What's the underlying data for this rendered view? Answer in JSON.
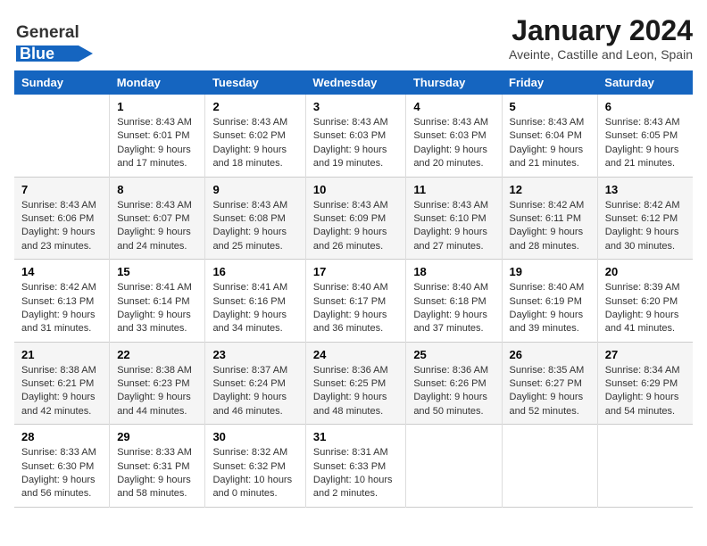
{
  "logo": {
    "general": "General",
    "blue": "Blue"
  },
  "header": {
    "title": "January 2024",
    "subtitle": "Aveinte, Castille and Leon, Spain"
  },
  "weekdays": [
    "Sunday",
    "Monday",
    "Tuesday",
    "Wednesday",
    "Thursday",
    "Friday",
    "Saturday"
  ],
  "weeks": [
    [
      {
        "day": "",
        "content": ""
      },
      {
        "day": "1",
        "content": "Sunrise: 8:43 AM\nSunset: 6:01 PM\nDaylight: 9 hours\nand 17 minutes."
      },
      {
        "day": "2",
        "content": "Sunrise: 8:43 AM\nSunset: 6:02 PM\nDaylight: 9 hours\nand 18 minutes."
      },
      {
        "day": "3",
        "content": "Sunrise: 8:43 AM\nSunset: 6:03 PM\nDaylight: 9 hours\nand 19 minutes."
      },
      {
        "day": "4",
        "content": "Sunrise: 8:43 AM\nSunset: 6:03 PM\nDaylight: 9 hours\nand 20 minutes."
      },
      {
        "day": "5",
        "content": "Sunrise: 8:43 AM\nSunset: 6:04 PM\nDaylight: 9 hours\nand 21 minutes."
      },
      {
        "day": "6",
        "content": "Sunrise: 8:43 AM\nSunset: 6:05 PM\nDaylight: 9 hours\nand 21 minutes."
      }
    ],
    [
      {
        "day": "7",
        "content": "Sunrise: 8:43 AM\nSunset: 6:06 PM\nDaylight: 9 hours\nand 23 minutes."
      },
      {
        "day": "8",
        "content": "Sunrise: 8:43 AM\nSunset: 6:07 PM\nDaylight: 9 hours\nand 24 minutes."
      },
      {
        "day": "9",
        "content": "Sunrise: 8:43 AM\nSunset: 6:08 PM\nDaylight: 9 hours\nand 25 minutes."
      },
      {
        "day": "10",
        "content": "Sunrise: 8:43 AM\nSunset: 6:09 PM\nDaylight: 9 hours\nand 26 minutes."
      },
      {
        "day": "11",
        "content": "Sunrise: 8:43 AM\nSunset: 6:10 PM\nDaylight: 9 hours\nand 27 minutes."
      },
      {
        "day": "12",
        "content": "Sunrise: 8:42 AM\nSunset: 6:11 PM\nDaylight: 9 hours\nand 28 minutes."
      },
      {
        "day": "13",
        "content": "Sunrise: 8:42 AM\nSunset: 6:12 PM\nDaylight: 9 hours\nand 30 minutes."
      }
    ],
    [
      {
        "day": "14",
        "content": "Sunrise: 8:42 AM\nSunset: 6:13 PM\nDaylight: 9 hours\nand 31 minutes."
      },
      {
        "day": "15",
        "content": "Sunrise: 8:41 AM\nSunset: 6:14 PM\nDaylight: 9 hours\nand 33 minutes."
      },
      {
        "day": "16",
        "content": "Sunrise: 8:41 AM\nSunset: 6:16 PM\nDaylight: 9 hours\nand 34 minutes."
      },
      {
        "day": "17",
        "content": "Sunrise: 8:40 AM\nSunset: 6:17 PM\nDaylight: 9 hours\nand 36 minutes."
      },
      {
        "day": "18",
        "content": "Sunrise: 8:40 AM\nSunset: 6:18 PM\nDaylight: 9 hours\nand 37 minutes."
      },
      {
        "day": "19",
        "content": "Sunrise: 8:40 AM\nSunset: 6:19 PM\nDaylight: 9 hours\nand 39 minutes."
      },
      {
        "day": "20",
        "content": "Sunrise: 8:39 AM\nSunset: 6:20 PM\nDaylight: 9 hours\nand 41 minutes."
      }
    ],
    [
      {
        "day": "21",
        "content": "Sunrise: 8:38 AM\nSunset: 6:21 PM\nDaylight: 9 hours\nand 42 minutes."
      },
      {
        "day": "22",
        "content": "Sunrise: 8:38 AM\nSunset: 6:23 PM\nDaylight: 9 hours\nand 44 minutes."
      },
      {
        "day": "23",
        "content": "Sunrise: 8:37 AM\nSunset: 6:24 PM\nDaylight: 9 hours\nand 46 minutes."
      },
      {
        "day": "24",
        "content": "Sunrise: 8:36 AM\nSunset: 6:25 PM\nDaylight: 9 hours\nand 48 minutes."
      },
      {
        "day": "25",
        "content": "Sunrise: 8:36 AM\nSunset: 6:26 PM\nDaylight: 9 hours\nand 50 minutes."
      },
      {
        "day": "26",
        "content": "Sunrise: 8:35 AM\nSunset: 6:27 PM\nDaylight: 9 hours\nand 52 minutes."
      },
      {
        "day": "27",
        "content": "Sunrise: 8:34 AM\nSunset: 6:29 PM\nDaylight: 9 hours\nand 54 minutes."
      }
    ],
    [
      {
        "day": "28",
        "content": "Sunrise: 8:33 AM\nSunset: 6:30 PM\nDaylight: 9 hours\nand 56 minutes."
      },
      {
        "day": "29",
        "content": "Sunrise: 8:33 AM\nSunset: 6:31 PM\nDaylight: 9 hours\nand 58 minutes."
      },
      {
        "day": "30",
        "content": "Sunrise: 8:32 AM\nSunset: 6:32 PM\nDaylight: 10 hours\nand 0 minutes."
      },
      {
        "day": "31",
        "content": "Sunrise: 8:31 AM\nSunset: 6:33 PM\nDaylight: 10 hours\nand 2 minutes."
      },
      {
        "day": "",
        "content": ""
      },
      {
        "day": "",
        "content": ""
      },
      {
        "day": "",
        "content": ""
      }
    ]
  ]
}
